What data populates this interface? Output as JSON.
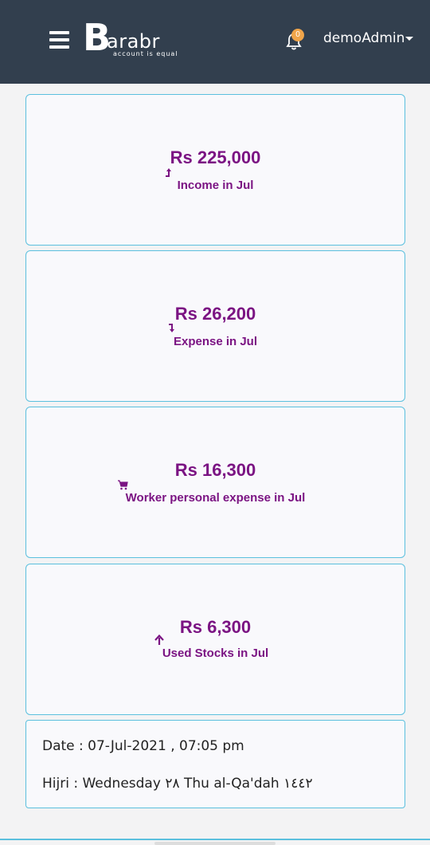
{
  "header": {
    "logo_letter": "B",
    "logo_text": "arabr",
    "logo_tagline": "account is equal",
    "notification_count": "0",
    "username": "demoAdmin"
  },
  "cards": [
    {
      "amount": "Rs 225,000",
      "label": "Income in Jul",
      "icon": "income-arrow-icon"
    },
    {
      "amount": "Rs 26,200",
      "label": "Expense in Jul",
      "icon": "expense-arrow-icon"
    },
    {
      "amount": "Rs 16,300",
      "label": "Worker personal expense in Jul",
      "icon": "cart-icon"
    },
    {
      "amount": "Rs 6,300",
      "label": "Used Stocks in Jul",
      "icon": "arrow-up-icon"
    }
  ],
  "info": {
    "date": "Date : 07-Jul-2021 , 07:05 pm",
    "hijri": "Hijri : Wednesday ٢٨ Thu al-Qa'dah ١٤٤٢"
  },
  "colors": {
    "header_bg": "#323f4e",
    "accent_purple": "#7b1483",
    "card_border": "#5bc0de",
    "badge": "#f0a54a"
  }
}
